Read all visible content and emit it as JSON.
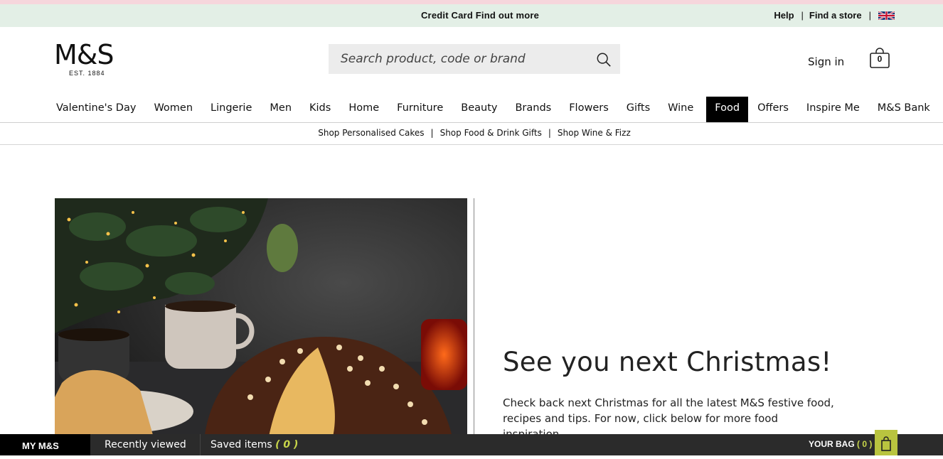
{
  "topbar": {
    "promo": "Credit Card Find out more",
    "help": "Help",
    "find_store": "Find a store"
  },
  "header": {
    "logo": "M&S",
    "logo_tagline": "EST. 1884",
    "search_placeholder": "Search product, code or brand",
    "sign_in": "Sign in",
    "bag_count": "0"
  },
  "nav": {
    "items": [
      "Valentine's Day",
      "Women",
      "Lingerie",
      "Men",
      "Kids",
      "Home",
      "Furniture",
      "Beauty",
      "Brands",
      "Flowers",
      "Gifts",
      "Wine",
      "Food",
      "Offers",
      "Inspire Me",
      "M&S Bank"
    ],
    "active": "Food"
  },
  "subnav": {
    "items": [
      "Shop Personalised Cakes",
      "Shop Food & Drink Gifts",
      "Shop Wine & Fizz"
    ]
  },
  "main": {
    "headline": "See you next Christmas!",
    "body": "Check back next Christmas for all the latest M&S festive food, recipes and tips. For now, click below for more food inspiration"
  },
  "footer": {
    "my_ms": "MY M&S",
    "recently_viewed": "Recently viewed",
    "saved_items_label": "Saved items",
    "saved_items_count": "( 0 )",
    "your_bag_label": "YOUR BAG",
    "your_bag_count": "( 0 )"
  },
  "colors": {
    "topbar_bg": "#e3efe6",
    "accent_yellow": "#c8d64a",
    "footer_bg": "#2b2b2b"
  }
}
